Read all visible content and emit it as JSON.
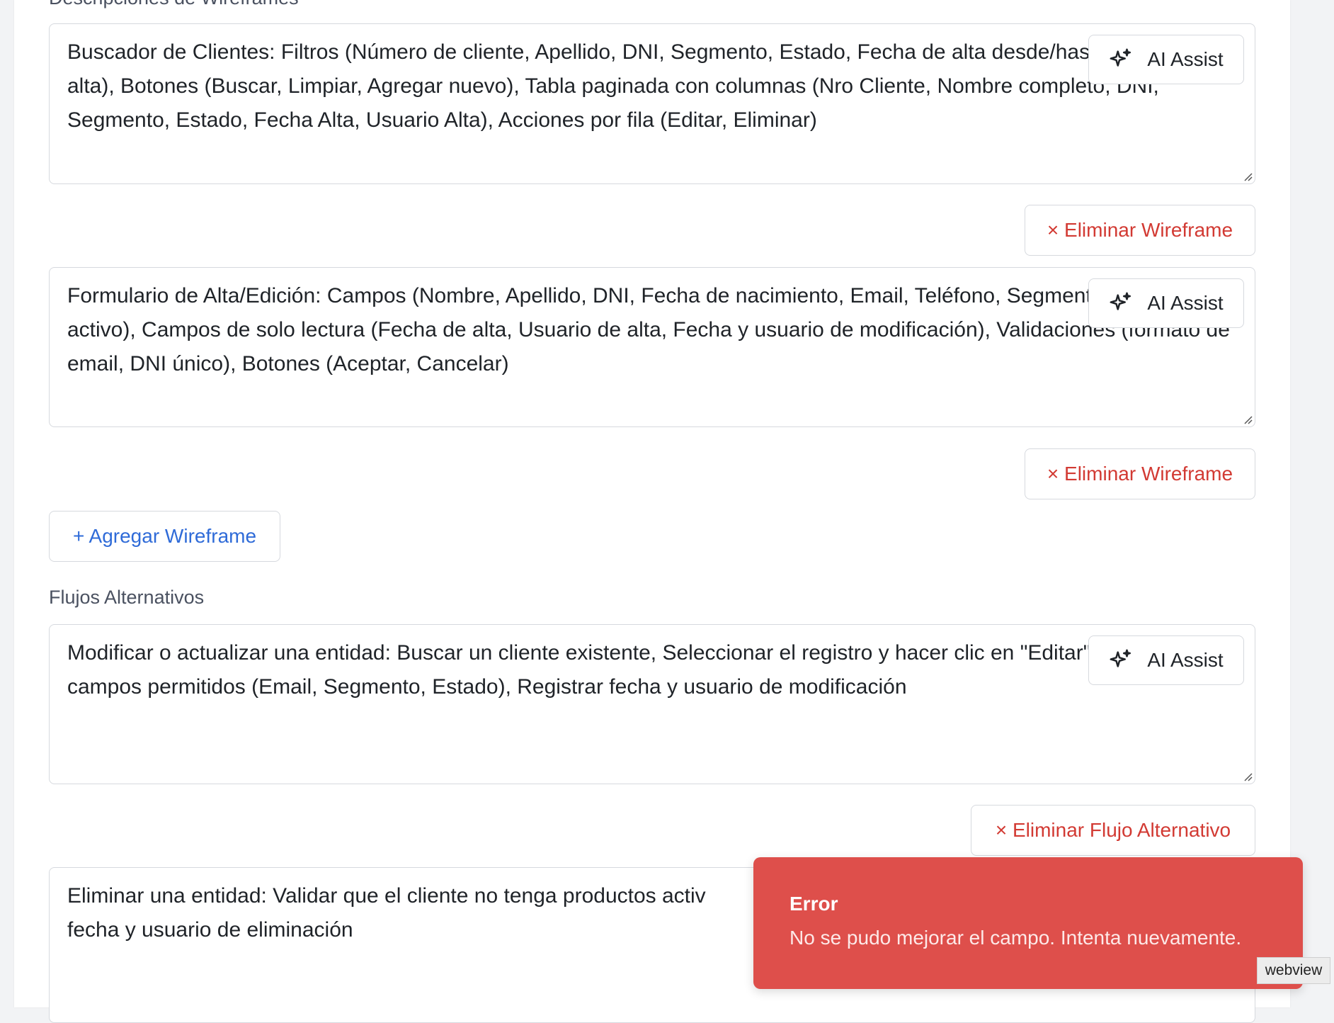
{
  "sections": {
    "wireframes_label": "Descripciones de Wireframes",
    "flujos_label": "Flujos Alternativos"
  },
  "wireframes": [
    {
      "text": "Buscador de Clientes: Filtros (Número de cliente, Apellido, DNI, Segmento, Estado, Fecha de alta desde/hasta, Usuario de alta), Botones (Buscar, Limpiar, Agregar nuevo), Tabla paginada con columnas (Nro Cliente, Nombre completo, DNI, Segmento, Estado, Fecha Alta, Usuario Alta), Acciones por fila (Editar, Eliminar)",
      "ai_label": "AI Assist",
      "remove_label": "× Eliminar Wireframe"
    },
    {
      "text": "Formulario de Alta/Edición: Campos (Nombre, Apellido, DNI, Fecha de nacimiento, Email, Teléfono, Segmento, Es cliente activo), Campos de solo lectura (Fecha de alta, Usuario de alta, Fecha y usuario de modificación), Validaciones (formato de email, DNI único), Botones (Aceptar, Cancelar)",
      "ai_label": "AI Assist",
      "remove_label": "× Eliminar Wireframe"
    }
  ],
  "add_wireframe_label": "+ Agregar Wireframe",
  "flujos": [
    {
      "text": "Modificar o actualizar una entidad: Buscar un cliente existente, Seleccionar el registro y hacer clic en \"Editar\", Modificar campos permitidos (Email, Segmento, Estado), Registrar fecha y usuario de modificación",
      "ai_label": "AI Assist",
      "remove_label": "× Eliminar Flujo Alternativo"
    },
    {
      "text": "Eliminar una entidad: Validar que el cliente no tenga productos activ\nfecha y usuario de eliminación"
    }
  ],
  "toast": {
    "title": "Error",
    "message": "No se pudo mejorar el campo. Intenta nuevamente."
  },
  "webview_tag": "webview",
  "colors": {
    "danger": "#d23a33",
    "primary": "#2f6bd8",
    "toast_bg": "#de4f4b"
  }
}
